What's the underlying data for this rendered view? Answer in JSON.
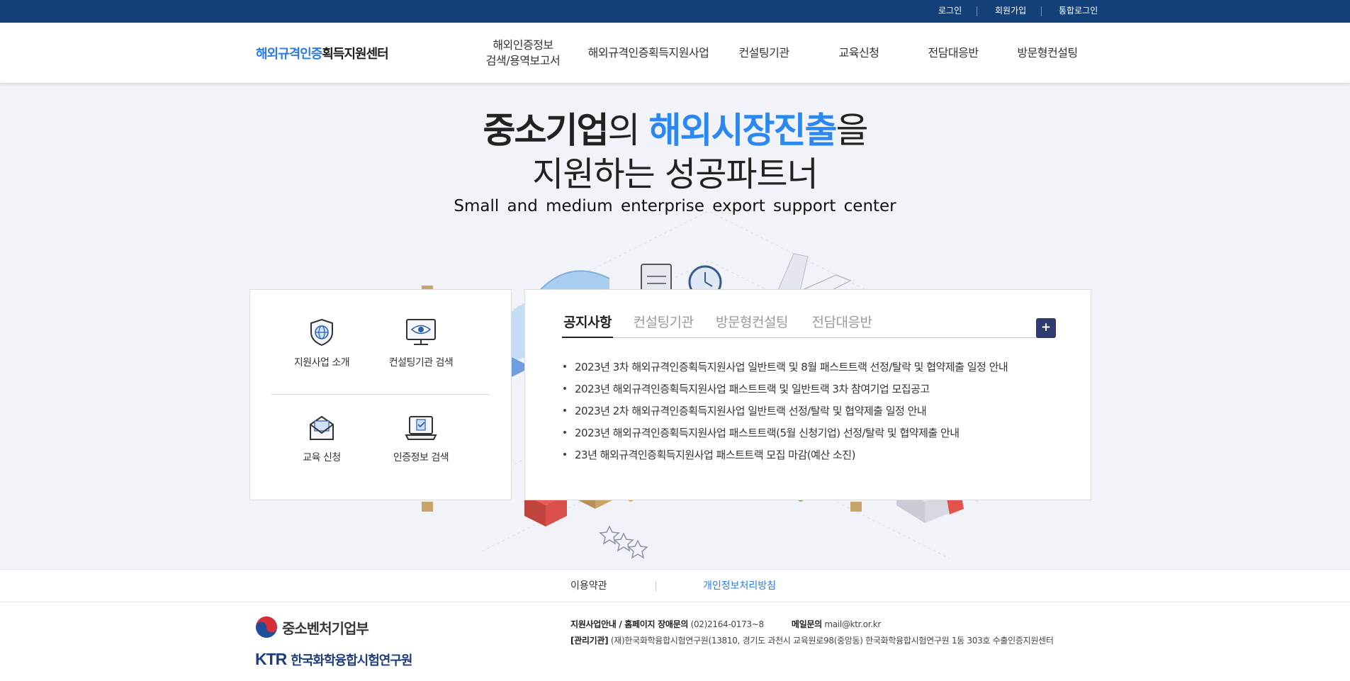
{
  "top_util": {
    "login": "로그인",
    "signup": "회원가입",
    "integrated_login": "통합로그인"
  },
  "header": {
    "logo_blue": "해외규격인증",
    "logo_dark": "획득지원센터",
    "nav": [
      "해외인증정보\n검색/용역보고서",
      "해외규격인증획득지원사업",
      "컨설팅기관",
      "교육신청",
      "전담대응반",
      "방문형컨설팅"
    ]
  },
  "hero": {
    "line1_a": "중소기업",
    "line1_b": "의 ",
    "line1_c": "해외시장진출",
    "line1_d": "을",
    "line2": "지원하는 성공파트너",
    "subtitle": "Small and medium enterprise export support center"
  },
  "quick_menu": {
    "items": [
      {
        "label": "지원사업 소개",
        "icon": "globe-shield-icon"
      },
      {
        "label": "컨설팅기관 검색",
        "icon": "monitor-eye-icon"
      },
      {
        "label": "교육 신청",
        "icon": "envelope-icon"
      },
      {
        "label": "인증정보 검색",
        "icon": "laptop-check-icon"
      }
    ]
  },
  "board": {
    "tabs": [
      "공지사항",
      "컨설팅기관",
      "방문형컨설팅",
      "전담대응반"
    ],
    "more_label": "+",
    "notices": [
      "2023년 3차 해외규격인증획득지원사업 일반트랙 및 8월 패스트트랙 선정/탈락 및 협약제출 일정 안내",
      "2023년 해외규격인증획득지원사업 패스트트랙 및 일반트랙 3차 참여기업 모집공고",
      "2023년 2차 해외규격인증획득지원사업 일반트랙 선정/탈락 및 협약제출 일정 안내",
      "2023년 해외규격인증획득지원사업 패스트트랙(5월 신청기업) 선정/탈락 및 협약제출 안내",
      "23년 해외규격인증획득지원사업 패스트트랙 모집 마감(예산 소진)"
    ]
  },
  "footer_links": {
    "terms": "이용약관",
    "privacy": "개인정보처리방침"
  },
  "footer": {
    "ministry": "중소벤처기업부",
    "ktr_abbr": "KTR",
    "ktr_name": "한국화학융합시험연구원",
    "info_label": "지원사업안내 / 홈페이지 장애문의",
    "phone": "(02)2164-0173~8",
    "mail_label": "메일문의",
    "mail": "mail@ktr.or.kr",
    "org_label": "[관리기관]",
    "org_text": "(재)한국화학융합시험연구원(13810, 경기도 과천시 교육원로98(중앙동) 한국화학융합시험연구원 1동 303호 수출인증지원센터"
  },
  "colors": {
    "topbar": "#14407a",
    "accent_blue": "#2b88f0",
    "more_button": "#2f3b6e",
    "privacy_link": "#2b7be6"
  }
}
